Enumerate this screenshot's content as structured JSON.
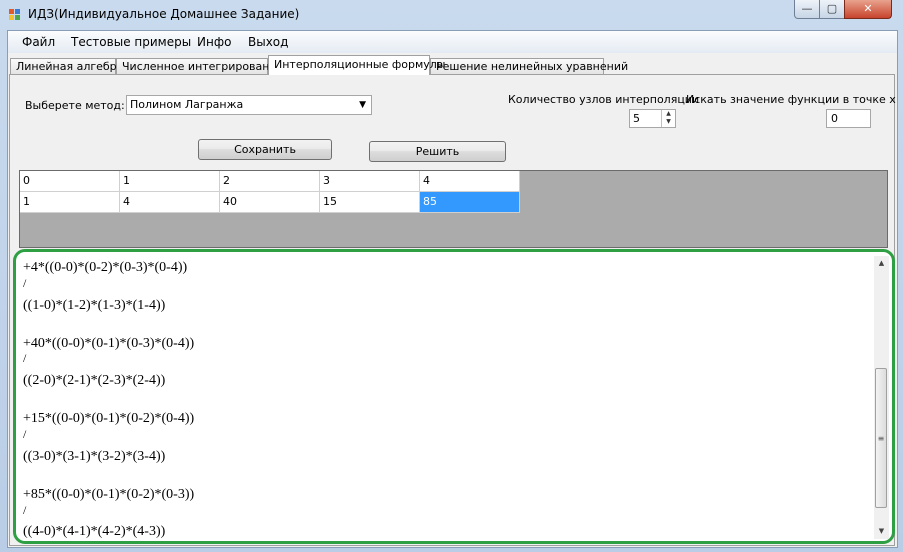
{
  "window": {
    "title": "ИДЗ(Индивидуальное Домашнее Задание)",
    "min": "—",
    "max": "▢",
    "close": "✕"
  },
  "menu": [
    "Файл",
    "Тестовые примеры",
    "Инфо",
    "Выход"
  ],
  "tabs": [
    "Линейная алгебра",
    "Численное интегрирование",
    "Интерполяционные формулы",
    "Решение нелинейных уравнений"
  ],
  "form": {
    "method_label": "Выберете метод:",
    "method_value": "Полином Лагранжа",
    "nodes_label": "Количество узлов интерполяции",
    "nodes_value": "5",
    "point_label": "Искать значение функции в точке x",
    "point_value": "0",
    "save_label": "Сохранить",
    "solve_label": "Решить"
  },
  "grid": {
    "row1": [
      "0",
      "1",
      "2",
      "3",
      "4"
    ],
    "row2": [
      "1",
      "4",
      "40",
      "15",
      "85"
    ]
  },
  "output_lines": [
    "+4*((0-0)*(0-2)*(0-3)*(0-4))",
    "/",
    "((1-0)*(1-2)*(1-3)*(1-4))",
    "",
    "+40*((0-0)*(0-1)*(0-3)*(0-4))",
    "/",
    "((2-0)*(2-1)*(2-3)*(2-4))",
    "",
    "+15*((0-0)*(0-1)*(0-2)*(0-4))",
    "/",
    "((3-0)*(3-1)*(3-2)*(3-4))",
    "",
    "+85*((0-0)*(0-1)*(0-2)*(0-3))",
    "/",
    "((4-0)*(4-1)*(4-2)*(4-3))"
  ],
  "accent": {
    "selection": "#3399ff",
    "highlight_border": "#2ea043"
  }
}
